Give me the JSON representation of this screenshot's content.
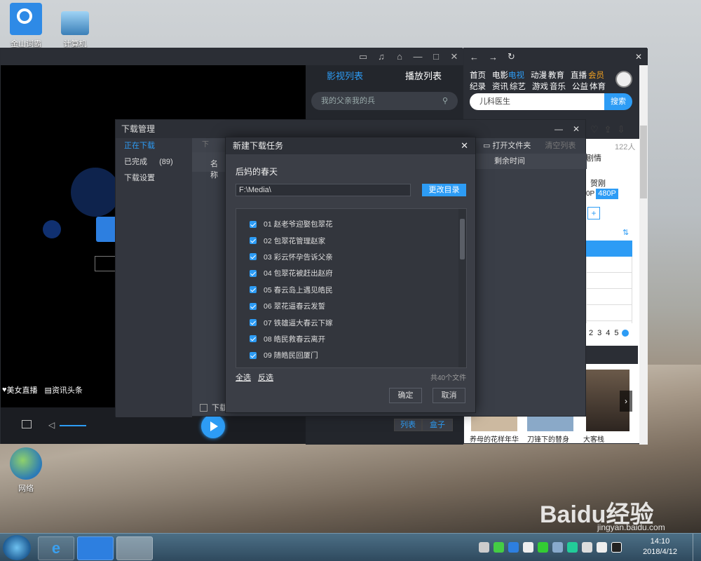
{
  "desktop": {
    "icons": [
      {
        "label": "金山词霸"
      },
      {
        "label": "计算机"
      },
      {
        "label": "网络"
      }
    ]
  },
  "player": {
    "tabs": [
      "影视列表",
      "播放列表"
    ],
    "search_placeholder": "我的父亲我的兵",
    "bottom_links": [
      "美女直播",
      "资讯头条"
    ],
    "list_button": "列表",
    "box_button": "盒子",
    "download_label": "下载"
  },
  "web": {
    "nav_rows": [
      [
        "首页",
        "电影",
        "电视",
        "动漫",
        "教育",
        "直播",
        "会员"
      ],
      [
        "纪录",
        "资讯",
        "综艺",
        "游戏",
        "音乐",
        "公益",
        "体育"
      ]
    ],
    "search_value": "儿科医生",
    "search_button": "搜索",
    "count": "122人",
    "text_juqing": "剧情",
    "text_hegang": "贺刚",
    "res_0": "0P",
    "res_480": "480P",
    "pages": [
      "2",
      "3",
      "4",
      "5"
    ],
    "thumbs": [
      "养母的花样年华",
      "刀锋下的替身",
      "大客栈"
    ]
  },
  "download_manager": {
    "title": "下载管理",
    "left_items": [
      {
        "label": "正在下载",
        "count": ""
      },
      {
        "label": "已完成",
        "count": "(89)"
      },
      {
        "label": "下载设置",
        "count": ""
      }
    ],
    "col_name": "名称",
    "col_download": "下",
    "open_folder": "打开文件夹",
    "clear_list": "清空列表",
    "remaining_time": "剩余时间",
    "footer_label": "下载"
  },
  "dialog": {
    "title": "新建下载任务",
    "show_title": "后妈的春天",
    "path": "F:\\Media\\",
    "change_dir": "更改目录",
    "episodes": [
      "01 赵老爷迎娶包翠花",
      "02 包翠花管理赵家",
      "03 彩云怀孕告诉父亲",
      "04 包翠花被赶出赵府",
      "05 春云岛上遇见皓民",
      "06 翠花逼春云发誓",
      "07 铁雄逼大春云下嫁",
      "08 皓民救春云离开",
      "09 随皓民回厦门"
    ],
    "select_all": "全选",
    "invert": "反选",
    "total": "共40个文件",
    "ok": "确定",
    "cancel": "取消"
  },
  "taskbar": {
    "time": "14:10",
    "date": "2018/4/12"
  },
  "watermark": {
    "brand": "Baidu经验",
    "url": "jingyan.baidu.com"
  }
}
